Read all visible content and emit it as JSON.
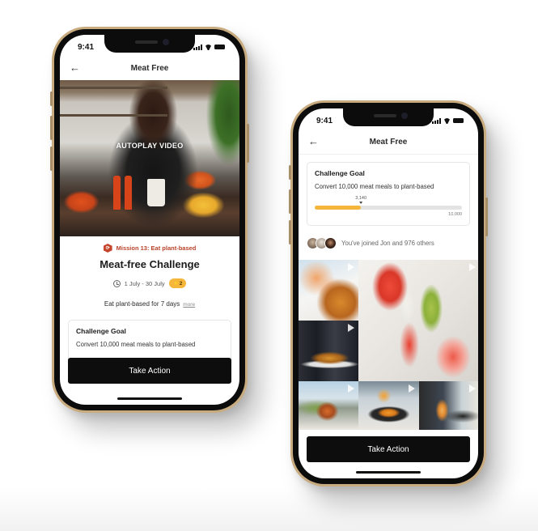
{
  "phones": [
    {
      "status_bar": {
        "time": "9:41"
      },
      "nav": {
        "title": "Meat Free",
        "back_icon": "arrow-left-icon"
      },
      "hero": {
        "overlay_label": "AUTOPLAY VIDEO"
      },
      "mission": {
        "icon": "hexagon-badge-icon",
        "label": "Mission 13: Eat plant-based"
      },
      "title": "Meat-free Challenge",
      "date_range": "1 July - 30 July",
      "points_badge": "⚡2",
      "description": "Eat plant-based for 7 days",
      "more_link": "more",
      "goal_card": {
        "title": "Challenge Goal",
        "text": "Convert 10,000 meat meals to plant-based"
      },
      "cta_label": "Take Action"
    },
    {
      "status_bar": {
        "time": "9:41"
      },
      "nav": {
        "title": "Meat Free",
        "back_icon": "arrow-left-icon"
      },
      "goal_card": {
        "title": "Challenge Goal",
        "text": "Convert 10,000 meat meals to plant-based",
        "progress": {
          "current": 3140,
          "current_label": "3,140",
          "max": 10000,
          "max_label": "10,000",
          "fraction": 0.314
        }
      },
      "participants": {
        "avatars": [
          "avatar-1",
          "avatar-2",
          "avatar-3"
        ],
        "text": "You've joined Jon and 976 others"
      },
      "gallery": {
        "tiles": [
          {
            "subject": "blossom branch",
            "type": "video"
          },
          {
            "subject": "fresh spring rolls",
            "type": "video"
          },
          {
            "subject": "served plate",
            "type": "video"
          },
          {
            "subject": "plated food table",
            "type": "video"
          },
          {
            "subject": "orange slices board",
            "type": "video"
          },
          {
            "subject": "infused water jar",
            "type": "video"
          }
        ]
      },
      "cta_label": "Take Action"
    }
  ],
  "colors": {
    "accent_yellow": "#f4b73c",
    "mission_red": "#b9422a",
    "cta_black": "#0d0d0d",
    "frame_gold": "#c8ab7f"
  }
}
